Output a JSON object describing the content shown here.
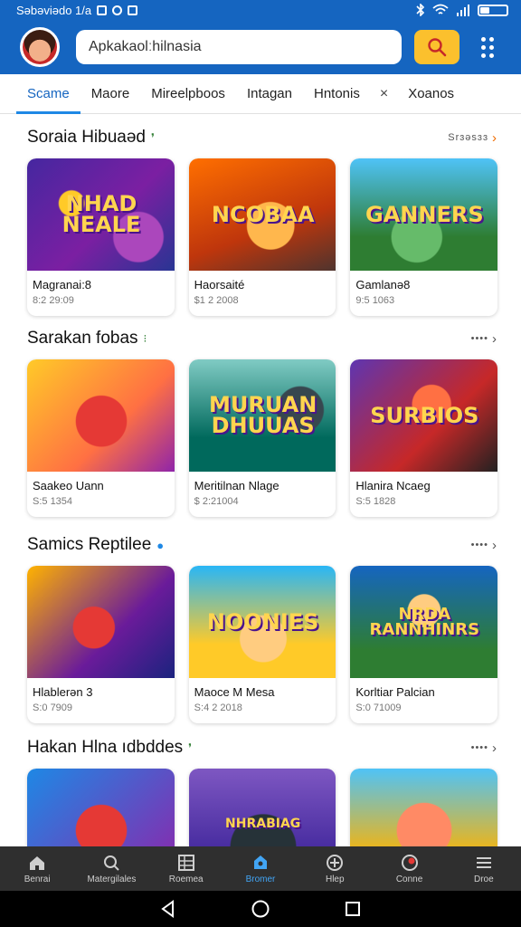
{
  "status_bar": {
    "time_text": "Səbəviədo 1/a"
  },
  "header": {
    "search_text": "Apkakaolːhilnasia"
  },
  "tabs": [
    {
      "label": "Scame",
      "active": true
    },
    {
      "label": "Maore"
    },
    {
      "label": "Mireelpboos"
    },
    {
      "label": "Intagan"
    },
    {
      "label": "Hntonis"
    },
    {
      "label": "×"
    },
    {
      "label": "Xoanos"
    }
  ],
  "sections": [
    {
      "title": "Soraia Hibuaəd",
      "more": "Srɜəsɜɜ",
      "cards": [
        {
          "art_text": "NHAD NEALE",
          "name": "Magranai:8",
          "meta": "8:2 29:09"
        },
        {
          "art_text": "NCOBAA",
          "name": "Haorsaité",
          "meta": "$1 2 2008"
        },
        {
          "art_text": "GANNERS",
          "name": "Gamlanə8",
          "meta": "9:5 1063"
        }
      ]
    },
    {
      "title": "Sarakan fobas",
      "more": "••••",
      "cards": [
        {
          "art_text": "",
          "name": "Saakeo Uann",
          "meta": "S:5 1354"
        },
        {
          "art_text": "MURUAN DHUUAS",
          "name": "Meritilnan Nlage",
          "meta": "$ 2:21004"
        },
        {
          "art_text": "SURBIOS",
          "name": "Hlanira Ncaeg",
          "meta": "S:5 1828"
        }
      ]
    },
    {
      "title": "Samics Reptilee",
      "more": "••••",
      "cards": [
        {
          "art_text": "",
          "name": "Hlablerən 3",
          "meta": "S:0 7909"
        },
        {
          "art_text": "NOONIES",
          "name": "Maoce M Mesa",
          "meta": "S:4 2 2018"
        },
        {
          "art_text": "NRDA RANNHINRS",
          "name": "Korltiar Palcian",
          "meta": "S:0 71009"
        }
      ]
    },
    {
      "title": "Hakan Hlna ıdbddes",
      "more": "••••",
      "cards": [
        {
          "art_text": "",
          "name": "",
          "meta": ""
        },
        {
          "art_text": "NHRABIAG",
          "name": "",
          "meta": ""
        },
        {
          "art_text": "",
          "name": "",
          "meta": ""
        }
      ]
    }
  ],
  "bottom_nav": [
    {
      "label": "Benrai",
      "icon": "home-icon"
    },
    {
      "label": "Matergilales",
      "icon": "search-icon"
    },
    {
      "label": "Roemea",
      "icon": "film-icon"
    },
    {
      "label": "Bromer",
      "icon": "store-icon",
      "active": true
    },
    {
      "label": "Hlep",
      "icon": "help-icon"
    },
    {
      "label": "Conne",
      "icon": "game-icon"
    },
    {
      "label": "Droe",
      "icon": "menu-icon"
    }
  ],
  "colors": {
    "primary": "#1565c0",
    "accent": "#fbc02d",
    "nav_active": "#42a5f5"
  }
}
